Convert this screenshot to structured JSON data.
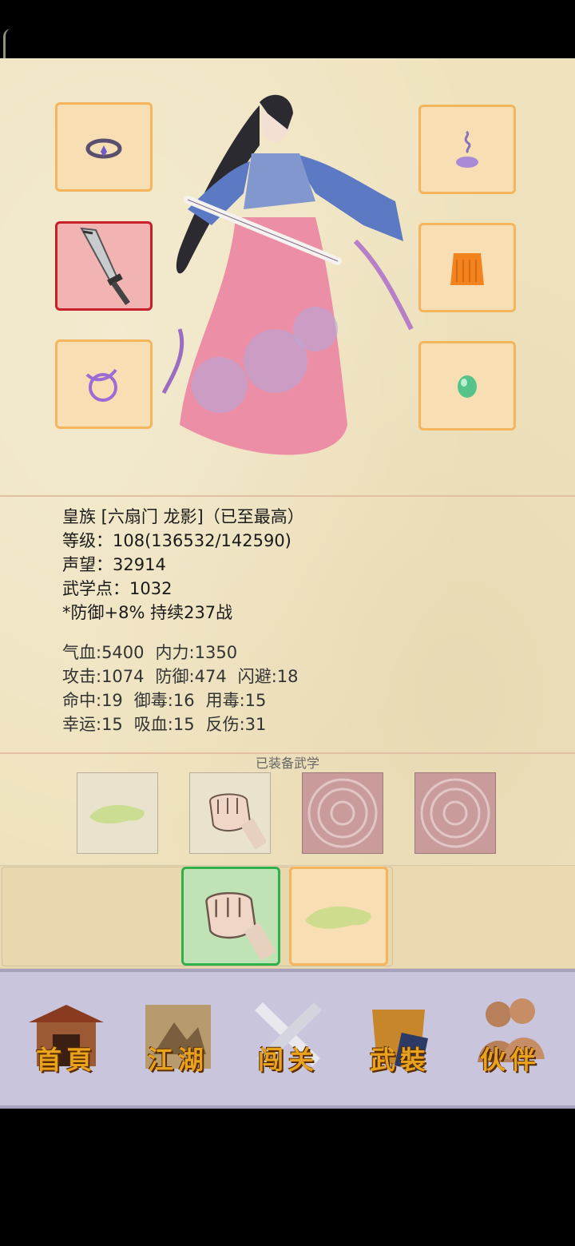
{
  "profile": {
    "title_line": "皇族 [六扇门 龙影]（已至最高）",
    "level_line": "等级：108(136532/142590)",
    "prestige_line": "声望：32914",
    "martial_points_line": "武学点：1032",
    "buff_line": "*防御+8% 持续237战"
  },
  "stats": [
    [
      "气血:5400",
      "内力:1350"
    ],
    [
      "攻击:1074",
      "防御:474",
      "闪避:18"
    ],
    [
      "命中:19",
      "御毒:16",
      "用毒:15"
    ],
    [
      "幸运:15",
      "吸血:15",
      "反伤:31"
    ]
  ],
  "skills_section_title": "已装备武学",
  "nav": {
    "home": "首頁",
    "jianghu": "江湖",
    "chuangguan": "闯关",
    "wuzhuang": "武裝",
    "huoban": "伙伴"
  },
  "colors": {
    "parchment": "#efe3bf",
    "slot_border": "#f4b55c",
    "selected_slot_border": "#c8202b",
    "equipped_green": "#2fb04a",
    "nav_bg": "#c9c5dd",
    "nav_label": "#e8a21e"
  }
}
